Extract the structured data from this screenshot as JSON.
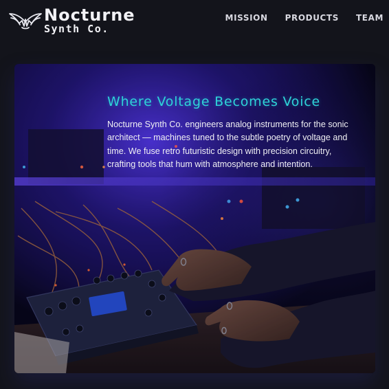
{
  "header": {
    "brand_name": "Nocturne",
    "brand_sub": "Synth Co.",
    "logo_icon": "winged-waveform-icon",
    "nav": [
      {
        "label": "MISSION"
      },
      {
        "label": "PRODUCTS"
      },
      {
        "label": "TEAM"
      }
    ]
  },
  "hero": {
    "title": "Where Voltage Becomes Voice",
    "body": "Nocturne Synth Co. engineers analog instruments for the sonic architect — machines tuned to the subtle poetry of voltage and time. We fuse retro futuristic design with precision circuitry, crafting tools that hum with atmosphere and intention.",
    "image_subject": "hands-on-modular-synthesizer-photo"
  },
  "colors": {
    "background": "#13141b",
    "accent_cyan": "#2ed3d8",
    "ambient_purple": "#5a3cff"
  }
}
